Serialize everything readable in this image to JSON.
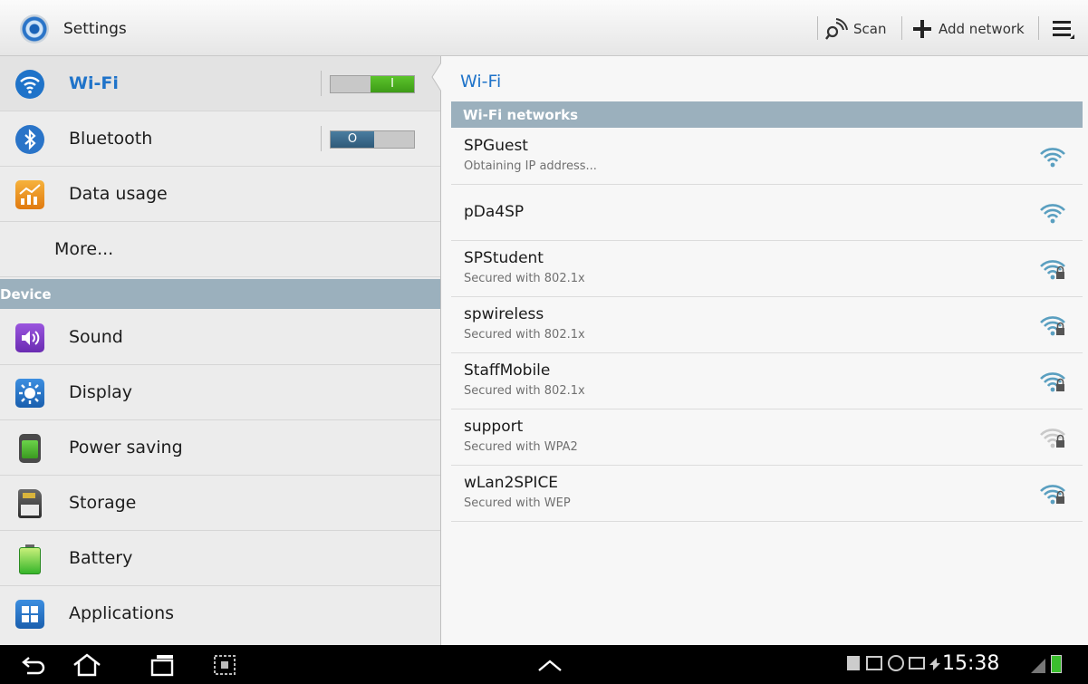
{
  "actionbar": {
    "title": "Settings",
    "app_icon": "settings-gear-icon",
    "scan_label": "Scan",
    "add_network_label": "Add network",
    "overflow_icon": "menu-overflow-icon"
  },
  "sidebar": {
    "items": [
      {
        "label": "Wi-Fi",
        "icon": "wifi-icon",
        "toggle": "I",
        "toggle_state": "on",
        "color": "#1f73c9"
      },
      {
        "label": "Bluetooth",
        "icon": "bluetooth-icon",
        "toggle": "O",
        "toggle_state": "off",
        "color": "#2a74c8"
      },
      {
        "label": "Data usage",
        "icon": "data-usage-icon",
        "color": "#f39a1e"
      },
      {
        "label": "More..."
      }
    ],
    "section_device": "Device",
    "device_items": [
      {
        "label": "Sound",
        "icon": "sound-icon",
        "color": "#7b3fc4"
      },
      {
        "label": "Display",
        "icon": "display-icon",
        "color": "#2a74c8"
      },
      {
        "label": "Power saving",
        "icon": "power-saving-icon",
        "color": "#4aa82d"
      },
      {
        "label": "Storage",
        "icon": "storage-icon",
        "color": "#555555"
      },
      {
        "label": "Battery",
        "icon": "battery-icon",
        "color": "#3bbf2e"
      },
      {
        "label": "Applications",
        "icon": "applications-icon",
        "color": "#2a74c8"
      }
    ]
  },
  "main": {
    "title": "Wi-Fi",
    "section_header": "Wi-Fi networks",
    "networks": [
      {
        "name": "SPGuest",
        "status": "Obtaining IP address...",
        "secured": false,
        "signal": "strong"
      },
      {
        "name": "pDa4SP",
        "status": "",
        "secured": false,
        "signal": "strong"
      },
      {
        "name": "SPStudent",
        "status": "Secured with 802.1x",
        "secured": true,
        "signal": "strong"
      },
      {
        "name": "spwireless",
        "status": "Secured with 802.1x",
        "secured": true,
        "signal": "strong"
      },
      {
        "name": "StaffMobile",
        "status": "Secured with 802.1x",
        "secured": true,
        "signal": "strong"
      },
      {
        "name": "support",
        "status": "Secured with WPA2",
        "secured": true,
        "signal": "weak"
      },
      {
        "name": "wLan2SPICE",
        "status": "Secured with WEP",
        "secured": true,
        "signal": "strong"
      }
    ]
  },
  "statusbar": {
    "time": "15:38",
    "back_icon": "back-icon",
    "home_icon": "home-icon",
    "recents_icon": "recent-apps-icon",
    "screenshot_icon": "screenshot-icon",
    "up_icon": "chevron-up-icon"
  },
  "colors": {
    "accent": "#1f73c9",
    "section_bg": "#9bb0bd",
    "toggle_on": "#4caf28",
    "toggle_off": "#3b6a8c"
  }
}
